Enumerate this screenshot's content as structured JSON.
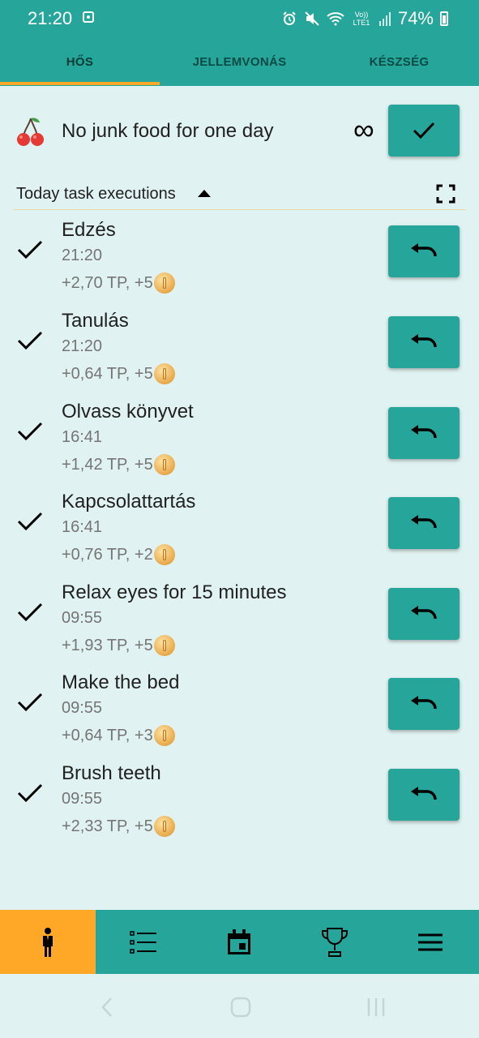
{
  "status_bar": {
    "time": "21:20",
    "signal_label": "Vo)) LTE1",
    "battery": "74%",
    "icons": [
      "alarm-icon",
      "mute-icon",
      "wifi-icon",
      "signal-icon",
      "battery-icon"
    ]
  },
  "tabs": [
    {
      "label": "HŐS",
      "active": true
    },
    {
      "label": "JELLEMVONÁS",
      "active": false
    },
    {
      "label": "KÉSZSÉG",
      "active": false
    }
  ],
  "habit": {
    "icon": "cherry-icon",
    "title": "No junk food for one day",
    "repeat_symbol": "∞"
  },
  "section": {
    "title": "Today task executions"
  },
  "executions": [
    {
      "name": "Edzés",
      "time": "21:20",
      "reward": "+2,70 TP, +5"
    },
    {
      "name": "Tanulás",
      "time": "21:20",
      "reward": "+0,64 TP, +5"
    },
    {
      "name": "Olvass könyvet",
      "time": "16:41",
      "reward": "+1,42 TP, +5"
    },
    {
      "name": "Kapcsolattartás",
      "time": "16:41",
      "reward": "+0,76 TP, +2"
    },
    {
      "name": "Relax eyes for 15 minutes",
      "time": "09:55",
      "reward": "+1,93 TP, +5"
    },
    {
      "name": "Make the bed",
      "time": "09:55",
      "reward": "+0,64 TP, +3"
    },
    {
      "name": "Brush teeth",
      "time": "09:55",
      "reward": "+2,33 TP, +5"
    }
  ],
  "bottom_nav": [
    {
      "icon": "hero-icon",
      "active": true
    },
    {
      "icon": "task-list-icon",
      "active": false
    },
    {
      "icon": "calendar-icon",
      "active": false
    },
    {
      "icon": "trophy-icon",
      "active": false
    },
    {
      "icon": "menu-icon",
      "active": false
    }
  ],
  "colors": {
    "primary": "#26a69a",
    "accent": "#ffa726",
    "background": "#e0f2f1"
  }
}
